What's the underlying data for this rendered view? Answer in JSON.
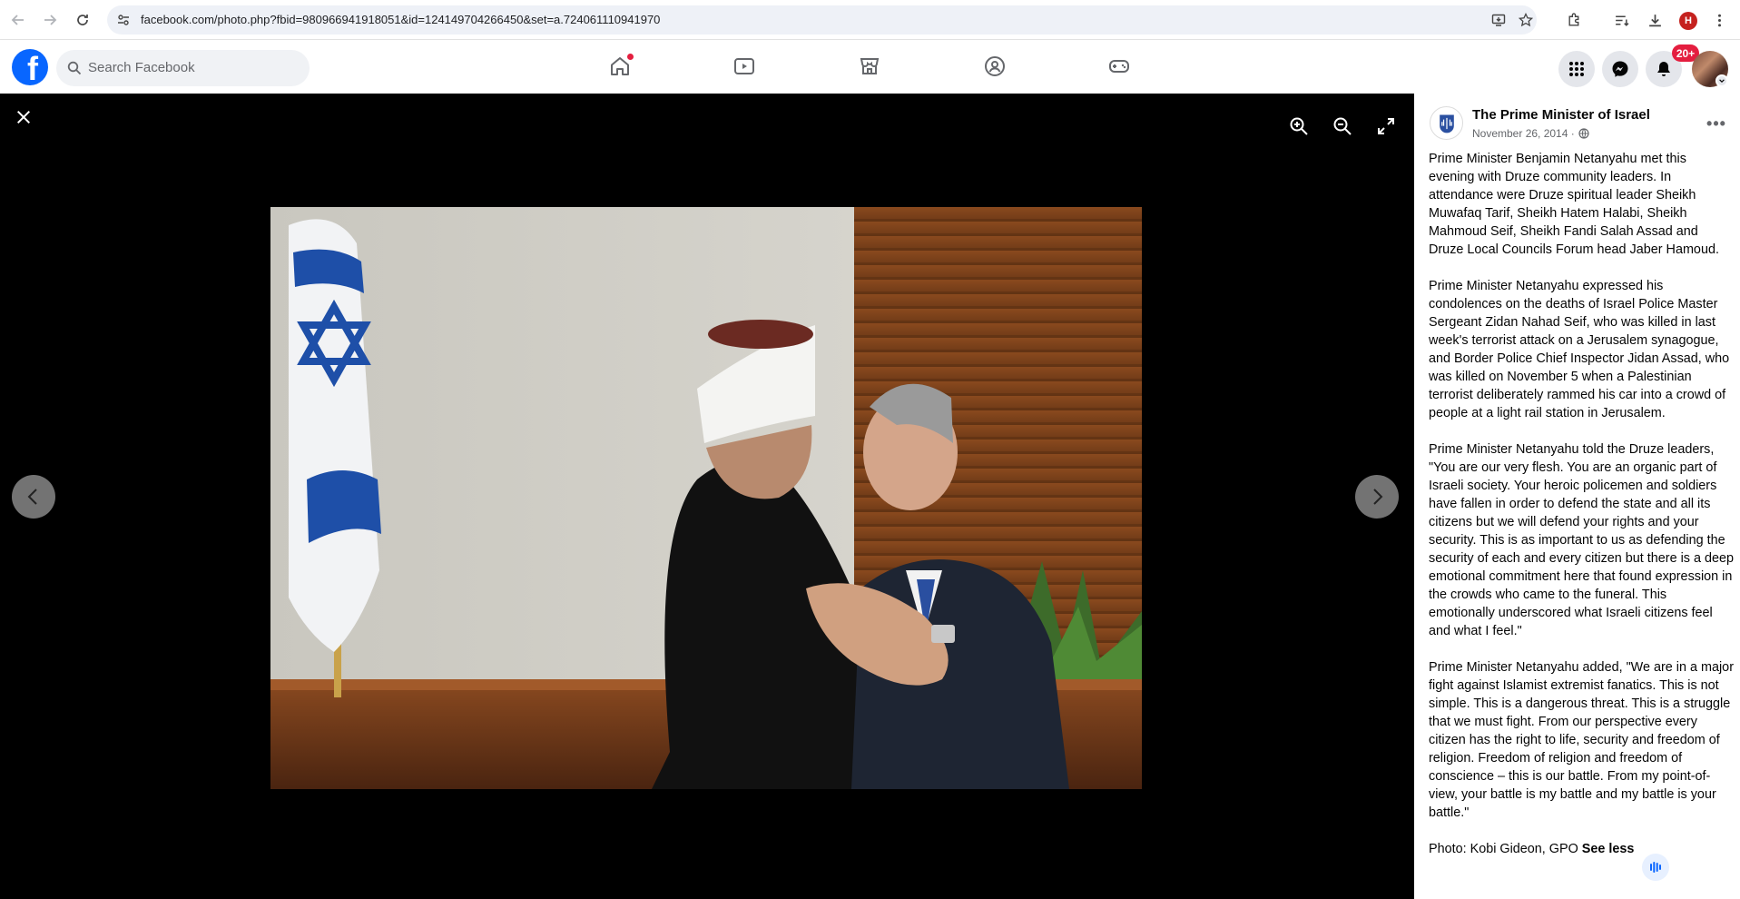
{
  "browser": {
    "url": "facebook.com/photo.php?fbid=980966941918051&id=124149704266450&set=a.724061110941970",
    "profile_initial": "H"
  },
  "facebook": {
    "search_placeholder": "Search Facebook",
    "notifications_badge": "20+",
    "nav_tabs": [
      "home-icon",
      "video-icon",
      "marketplace-icon",
      "groups-icon",
      "gaming-icon"
    ]
  },
  "viewer": {
    "photo_description": "Photo of two men embracing in front of an Israeli flag"
  },
  "post": {
    "page_name": "The Prime Minister of Israel",
    "date": "November 26, 2014 ·",
    "paragraphs": [
      "Prime Minister Benjamin Netanyahu met this evening with Druze community leaders. In attendance were Druze spiritual leader Sheikh Muwafaq Tarif, Sheikh Hatem Halabi, Sheikh Mahmoud Seif, Sheikh Fandi Salah Assad and Druze Local Councils Forum head Jaber Hamoud.",
      "Prime Minister Netanyahu expressed his condolences on the deaths of Israel Police Master Sergeant Zidan Nahad Seif, who was killed in last week's terrorist attack on a Jerusalem synagogue, and Border Police Chief Inspector Jidan Assad, who was killed on November 5 when a Palestinian terrorist deliberately rammed his car into a crowd of people at a light rail station in Jerusalem.",
      "Prime Minister Netanyahu told the Druze leaders, \"You are our very flesh. You are an organic part of Israeli society. Your heroic policemen and soldiers have fallen in order to defend the state and all its citizens but we will defend your rights and your security. This is as important to us as defending the security of each and every citizen but there is a deep emotional commitment here that found expression in the crowds who came to the funeral. This emotionally underscored what Israeli citizens feel and what I feel.\"",
      "Prime Minister Netanyahu added, \"We are in a major fight against Islamist extremist fanatics. This is not simple. This is a dangerous threat. This is a struggle that we must fight. From our perspective every citizen has the right to life, security and freedom of religion. Freedom of religion and freedom of conscience – this is our battle. From my point-of-view, your battle is my battle and my battle is your battle.\""
    ],
    "credit": "Photo: Kobi Gideon, GPO",
    "see_less": "See less"
  },
  "colors": {
    "fb_blue": "#0866ff",
    "badge_red": "#e41e3f",
    "text_secondary": "#65676b"
  }
}
